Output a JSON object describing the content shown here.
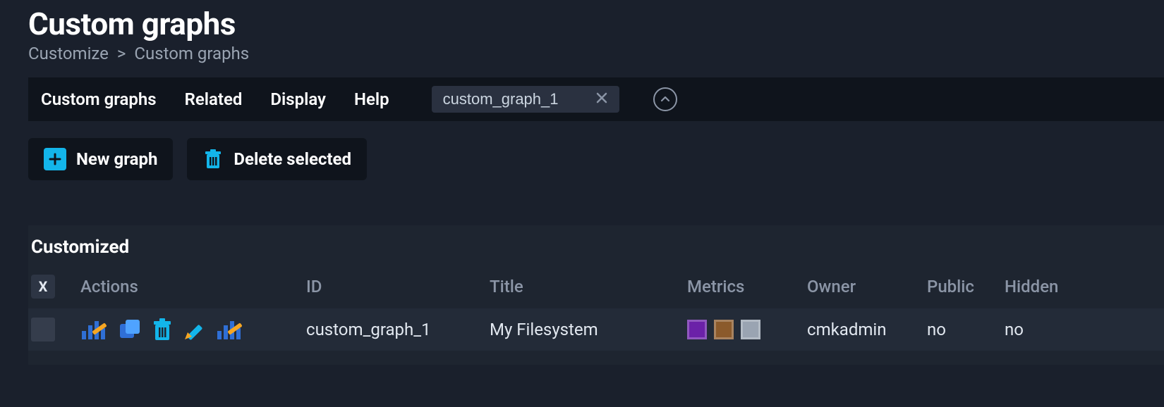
{
  "header": {
    "title": "Custom graphs",
    "breadcrumb": [
      "Customize",
      "Custom graphs"
    ]
  },
  "menubar": {
    "items": [
      "Custom graphs",
      "Related",
      "Display",
      "Help"
    ],
    "search_value": "custom_graph_1"
  },
  "actions": {
    "new_graph": "New graph",
    "delete_selected": "Delete selected"
  },
  "table": {
    "section_title": "Customized",
    "select_all_label": "X",
    "columns": [
      "Actions",
      "ID",
      "Title",
      "Metrics",
      "Owner",
      "Public",
      "Hidden"
    ],
    "rows": [
      {
        "id": "custom_graph_1",
        "title": "My Filesystem",
        "metrics_colors": [
          "#6b21a8",
          "#8b5a2b",
          "#9aa4b2"
        ],
        "owner": "cmkadmin",
        "public": "no",
        "hidden": "no"
      }
    ]
  },
  "icons": {
    "edit_chart": "edit-chart-icon",
    "clone": "clone-icon",
    "delete": "trash-icon",
    "pencil": "pencil-icon",
    "chart": "chart-icon"
  }
}
